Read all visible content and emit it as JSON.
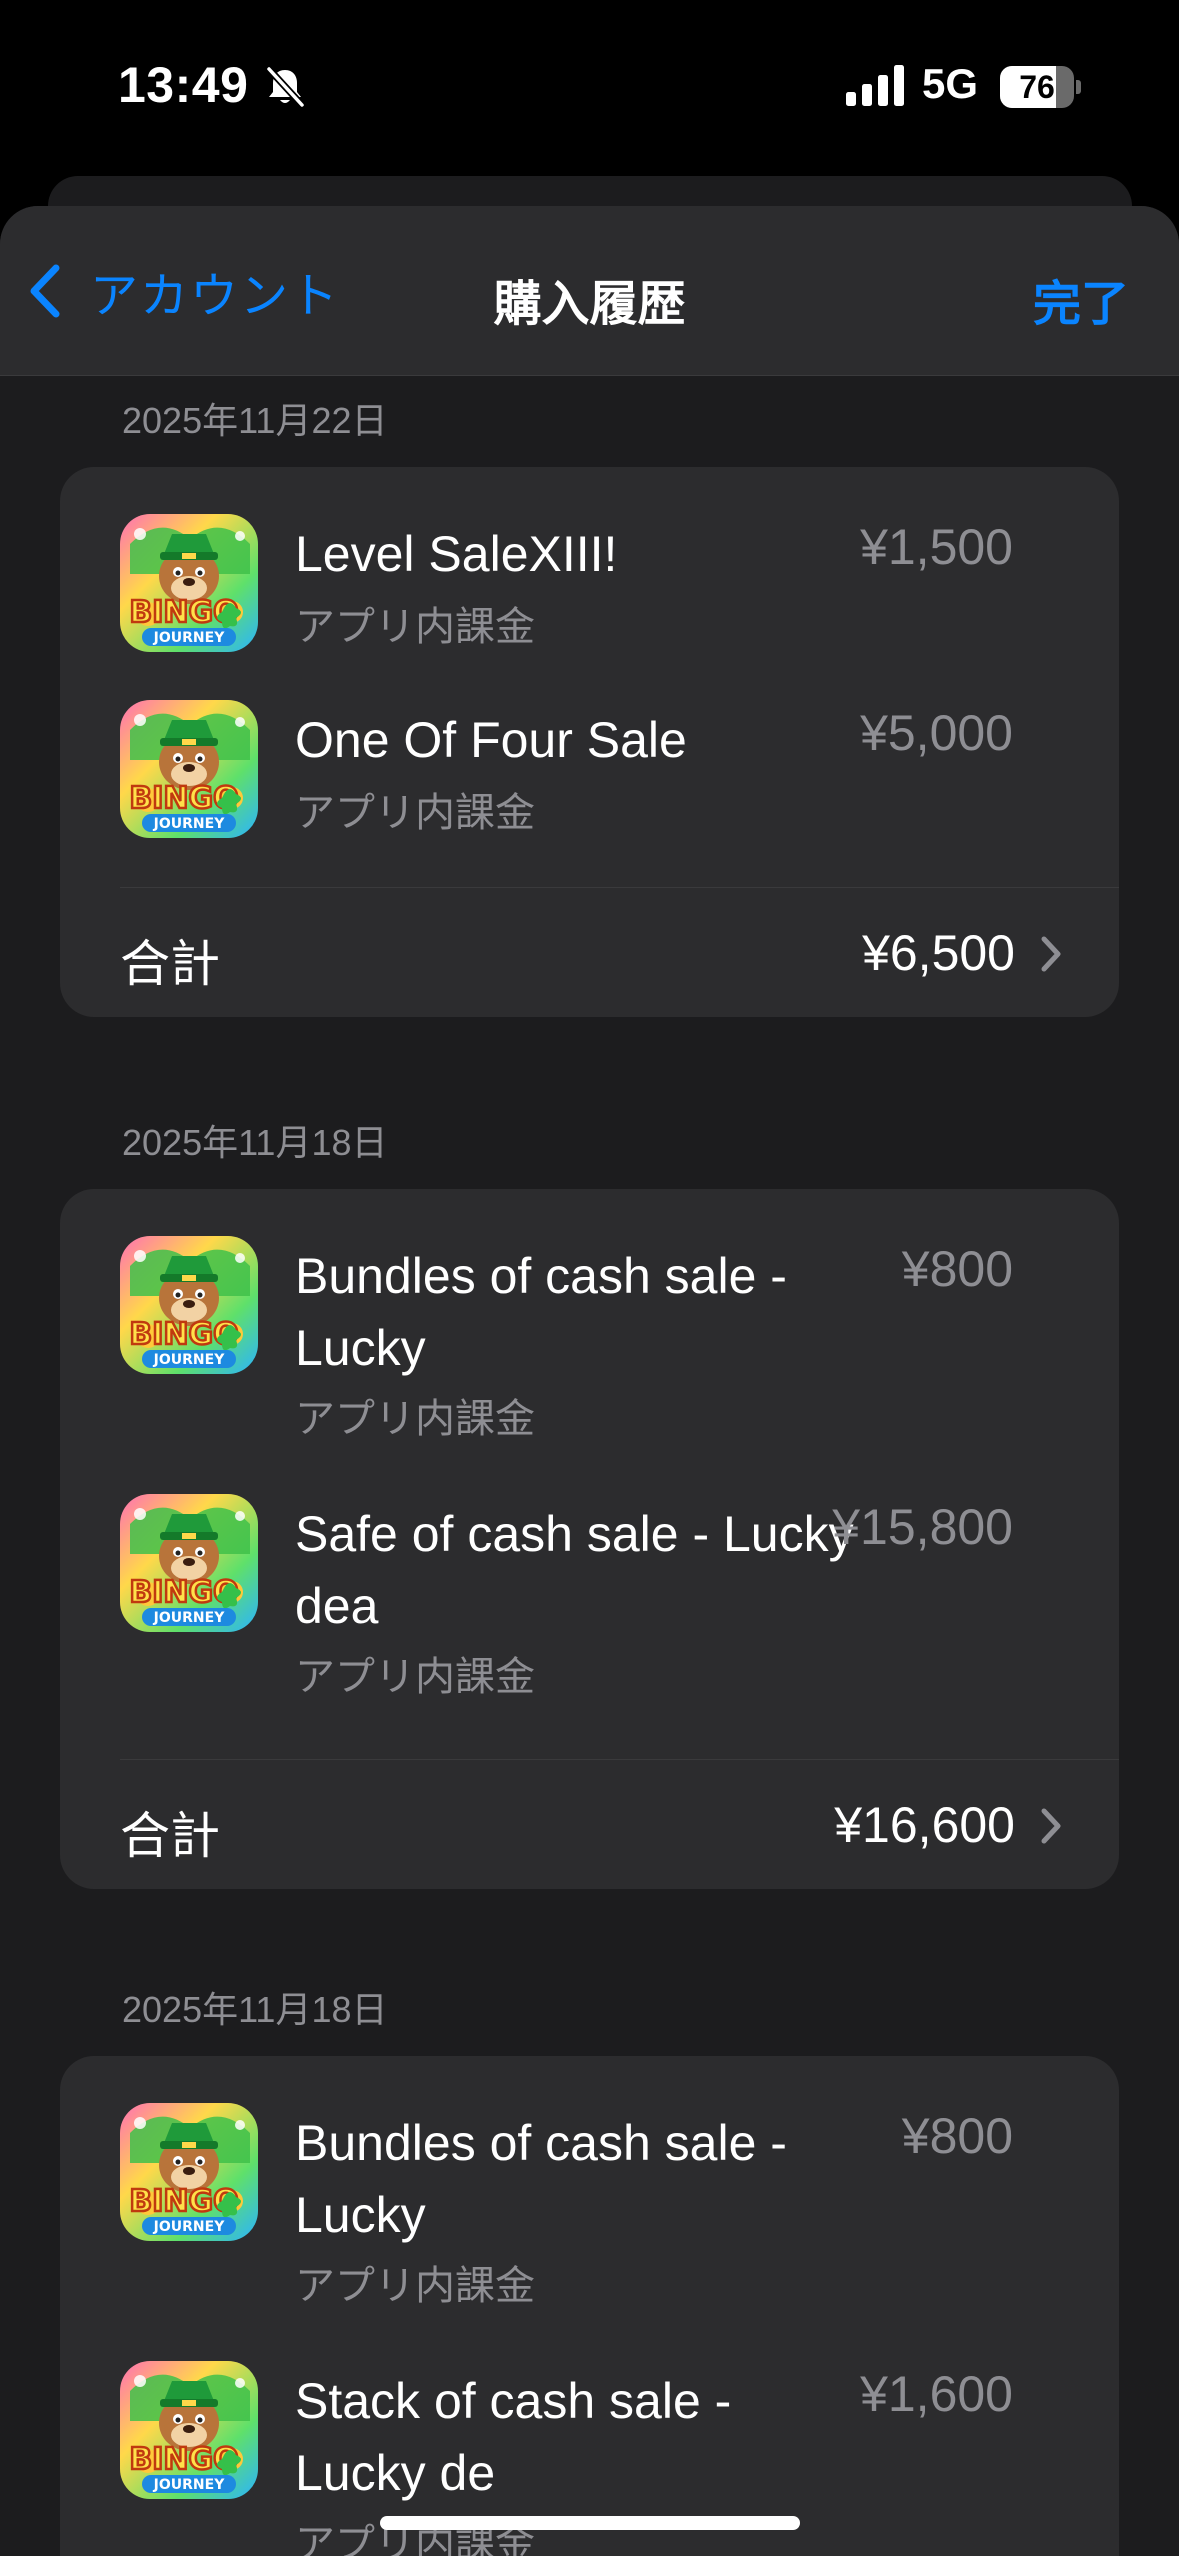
{
  "status_bar": {
    "time": "13:49",
    "network": "5G",
    "battery": "76",
    "battery_fraction": 0.76
  },
  "nav": {
    "back_label": "アカウント",
    "title": "購入履歴",
    "done_label": "完了"
  },
  "colors": {
    "accent": "#0a84ff",
    "background": "#1c1c1e",
    "card": "#2c2c2e",
    "secondary_text": "#8e8e93"
  },
  "sections": [
    {
      "date": "2025年11月22日",
      "items": [
        {
          "title": "Level SaleXIII!",
          "subtitle": "アプリ内課金",
          "price": "¥1,500",
          "icon": "bingo-journey-app-icon"
        },
        {
          "title": "One Of Four Sale",
          "subtitle": "アプリ内課金",
          "price": "¥5,000",
          "icon": "bingo-journey-app-icon"
        }
      ],
      "total_label": "合計",
      "total": "¥6,500"
    },
    {
      "date": "2025年11月18日",
      "items": [
        {
          "title": "Bundles of cash sale - Lucky",
          "subtitle": "アプリ内課金",
          "price": "¥800",
          "icon": "bingo-journey-app-icon"
        },
        {
          "title": "Safe of cash sale - Lucky dea",
          "subtitle": "アプリ内課金",
          "price": "¥15,800",
          "icon": "bingo-journey-app-icon"
        }
      ],
      "total_label": "合計",
      "total": "¥16,600"
    },
    {
      "date": "2025年11月18日",
      "items": [
        {
          "title": "Bundles of cash sale - Lucky",
          "subtitle": "アプリ内課金",
          "price": "¥800",
          "icon": "bingo-journey-app-icon"
        },
        {
          "title": "Stack of cash sale - Lucky de",
          "subtitle": "アプリ内課金",
          "price": "¥1,600",
          "icon": "bingo-journey-app-icon"
        }
      ]
    }
  ]
}
